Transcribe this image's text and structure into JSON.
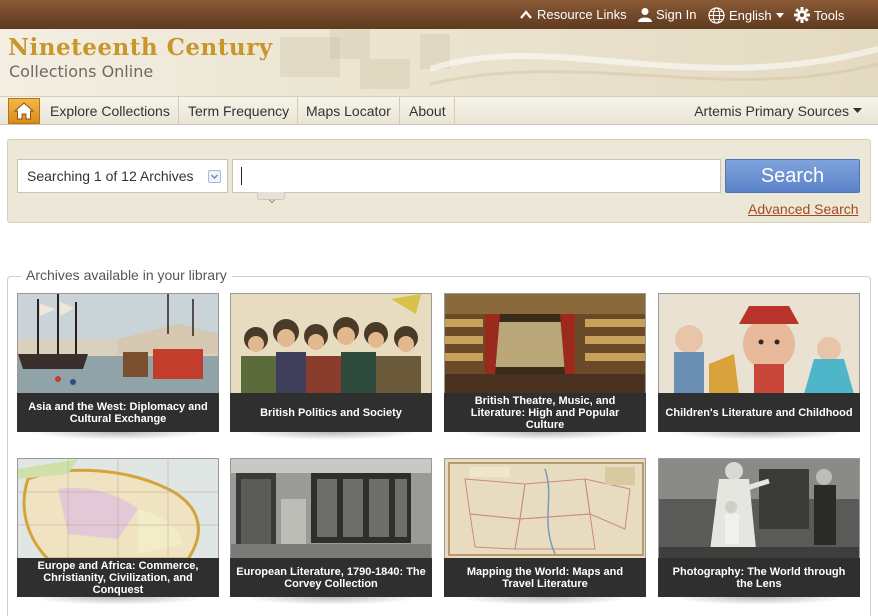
{
  "topbar": {
    "resource_links": "Resource Links",
    "sign_in": "Sign In",
    "language": "English",
    "tools": "Tools"
  },
  "banner": {
    "title": "Nineteenth Century",
    "subtitle": "Collections Online"
  },
  "nav": {
    "items": [
      {
        "label": "Explore Collections"
      },
      {
        "label": "Term Frequency"
      },
      {
        "label": "Maps Locator"
      },
      {
        "label": "About"
      }
    ],
    "right_menu": "Artemis Primary Sources"
  },
  "search": {
    "scope_label": "Searching 1 of 12 Archives",
    "query": "",
    "button": "Search",
    "advanced_link": "Advanced Search"
  },
  "archives": {
    "legend": "Archives available in your library",
    "items": [
      {
        "caption": "Asia and the West: Diplomacy and Cultural Exchange",
        "image": "ships-painting"
      },
      {
        "caption": "British Politics and Society",
        "image": "crowd-illustration"
      },
      {
        "caption": "British Theatre, Music, and Literature: High and Popular Culture",
        "image": "theatre-interior"
      },
      {
        "caption": "Children's Literature and Childhood",
        "image": "children-illustration"
      },
      {
        "caption": "Europe and Africa: Commerce, Christianity, Civilization, and Conquest",
        "image": "africa-map"
      },
      {
        "caption": "European Literature, 1790-1840: The Corvey Collection",
        "image": "library-photo"
      },
      {
        "caption": "Mapping the World: Maps and Travel Literature",
        "image": "us-map"
      },
      {
        "caption": "Photography: The World through the Lens",
        "image": "vintage-photo"
      }
    ]
  },
  "colors": {
    "topbar": "#6b4426",
    "title_gold": "#c8962b",
    "home_orange": "#e39a24",
    "search_blue": "#6a8fd1",
    "advanced_link": "#a44a1f",
    "caption_bg": "#2f2f2f"
  }
}
